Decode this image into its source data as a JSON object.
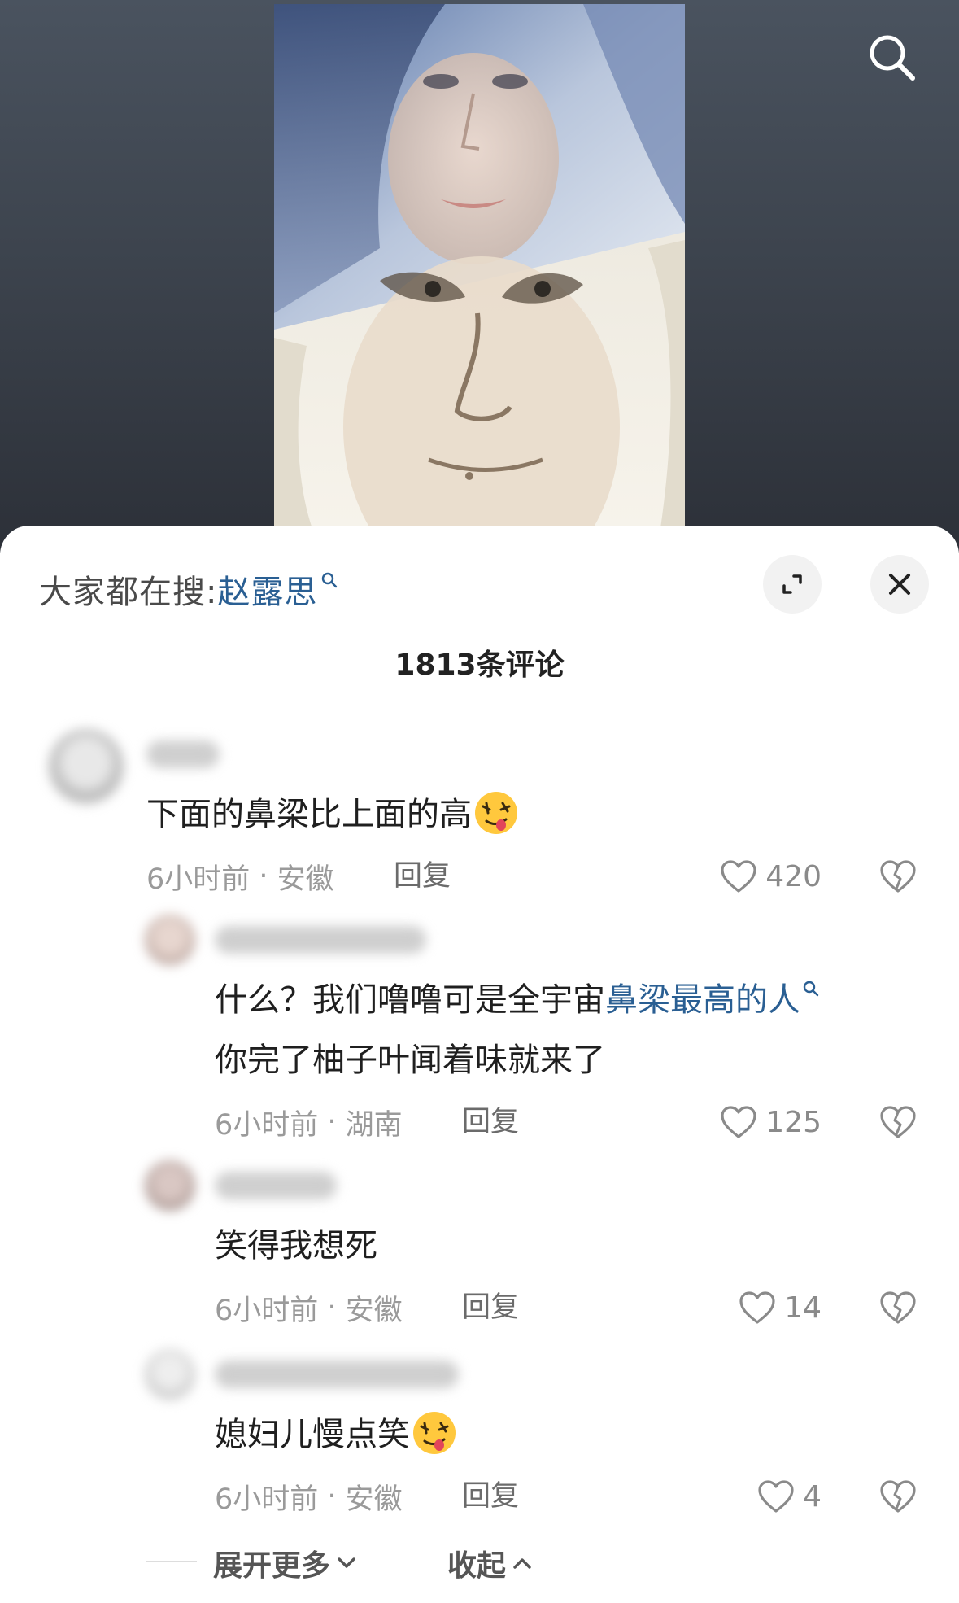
{
  "header": {
    "search_icon": "search-icon"
  },
  "suggest": {
    "prefix": "大家都在搜:",
    "term": "赵露思"
  },
  "comments_title": "1813条评论",
  "comments": [
    {
      "text": "下面的鼻梁比上面的高",
      "emoji": "drooling-face",
      "time": "6小时前",
      "location": "安徽",
      "reply_label": "回复",
      "likes": "420"
    },
    {
      "text_line1_prefix": "什么？我们噜噜可是全宇宙",
      "text_line1_link": "鼻梁最高的人",
      "text_line2": "你完了柚子叶闻着味就来了",
      "time": "6小时前",
      "location": "湖南",
      "reply_label": "回复",
      "likes": "125"
    },
    {
      "text": "笑得我想死",
      "time": "6小时前",
      "location": "安徽",
      "reply_label": "回复",
      "likes": "14"
    },
    {
      "text": "媳妇儿慢点笑",
      "emoji": "drooling-face",
      "time": "6小时前",
      "location": "安徽",
      "reply_label": "回复",
      "likes": "4"
    }
  ],
  "footer": {
    "more_label": "展开更多",
    "collapse_label": "收起"
  },
  "colors": {
    "link": "#2a5f93",
    "meta": "#9a9a9a",
    "text": "#1f1f1f"
  }
}
